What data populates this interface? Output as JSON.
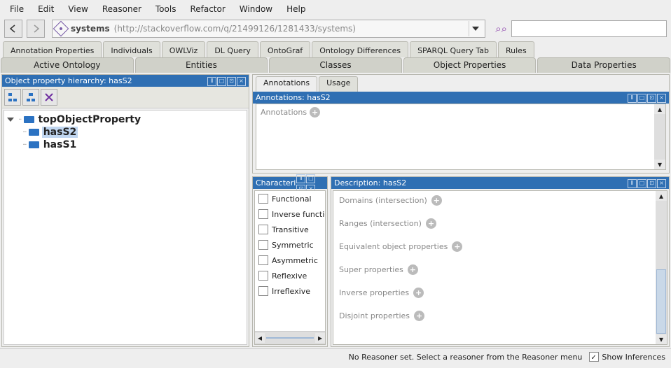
{
  "menubar": [
    "File",
    "Edit",
    "View",
    "Reasoner",
    "Tools",
    "Refactor",
    "Window",
    "Help"
  ],
  "address": {
    "name": "systems",
    "uri": "(http://stackoverflow.com/q/21499126/1281433/systems)"
  },
  "tabs_row1": [
    "Annotation Properties",
    "Individuals",
    "OWLViz",
    "DL Query",
    "OntoGraf",
    "Ontology Differences",
    "SPARQL Query Tab",
    "Rules"
  ],
  "tabs_row2": [
    "Active Ontology",
    "Entities",
    "Classes",
    "Object Properties",
    "Data Properties"
  ],
  "tabs_row2_active": "Object Properties",
  "left_panel": {
    "title": "Object property hierarchy: hasS2",
    "tree": {
      "root": "topObjectProperty",
      "children": [
        "hasS2",
        "hasS1"
      ],
      "selected": "hasS2"
    }
  },
  "right_top": {
    "tabs": [
      "Annotations",
      "Usage"
    ],
    "active": "Annotations",
    "header": "Annotations: hasS2",
    "section_label": "Annotations"
  },
  "characteristics": {
    "header": "Characteri",
    "items": [
      "Functional",
      "Inverse functio",
      "Transitive",
      "Symmetric",
      "Asymmetric",
      "Reflexive",
      "Irreflexive"
    ]
  },
  "description": {
    "header": "Description: hasS2",
    "sections": [
      "Domains (intersection)",
      "Ranges (intersection)",
      "Equivalent object properties",
      "Super properties",
      "Inverse properties",
      "Disjoint properties"
    ]
  },
  "status": {
    "message": "No Reasoner set. Select a reasoner from the Reasoner menu",
    "checkbox_label": "Show Inferences",
    "checkbox_checked": true
  }
}
